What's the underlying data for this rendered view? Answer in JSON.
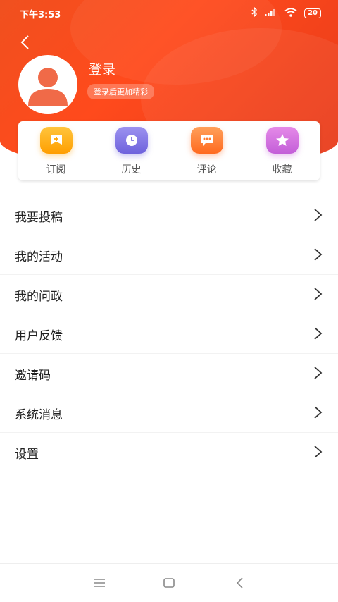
{
  "status_bar": {
    "time": "下午3:53",
    "battery": "20"
  },
  "profile": {
    "title": "登录",
    "subtitle": "登录后更加精彩"
  },
  "quick_actions": [
    {
      "label": "订阅",
      "icon": "subscribe-icon",
      "color": "#ffb020"
    },
    {
      "label": "历史",
      "icon": "history-clock-icon",
      "color": "#7d71e2"
    },
    {
      "label": "评论",
      "icon": "comment-icon",
      "color": "#ff7a30"
    },
    {
      "label": "收藏",
      "icon": "star-icon",
      "color": "#cf6ae0"
    }
  ],
  "menu": [
    {
      "label": "我要投稿"
    },
    {
      "label": "我的活动"
    },
    {
      "label": "我的问政"
    },
    {
      "label": "用户反馈"
    },
    {
      "label": "邀请码"
    },
    {
      "label": "系统消息"
    },
    {
      "label": "设置"
    }
  ],
  "colors": {
    "header": "#f0501f",
    "text": "#222222",
    "muted": "#555555"
  }
}
